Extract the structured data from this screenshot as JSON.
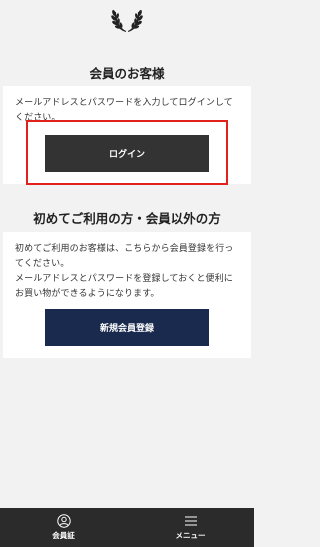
{
  "logo": {
    "icon": "laurel-wreath-icon"
  },
  "login_section": {
    "title": "会員のお客様",
    "description": "メールアドレスとパスワードを入力してログインしてください。",
    "login_button": "ログイン",
    "highlight_color": "#e0211c"
  },
  "guest_section": {
    "title": "初めてご利用の方・会員以外の方",
    "description_1": "初めてご利用のお客様は、こちらから会員登録を行ってください。",
    "description_2": "メールアドレスとパスワードを登録しておくと便利にお買い物ができるようになります。",
    "register_button": "新規会員登録"
  },
  "bottom_nav": {
    "member_card": {
      "label": "会員証",
      "icon": "user-circle-icon"
    },
    "menu": {
      "label": "メニュー",
      "icon": "hamburger-menu-icon"
    }
  },
  "colors": {
    "login_button": "#333333",
    "register_button": "#1a2a4e",
    "bottom_bar": "#2b2b2b"
  }
}
